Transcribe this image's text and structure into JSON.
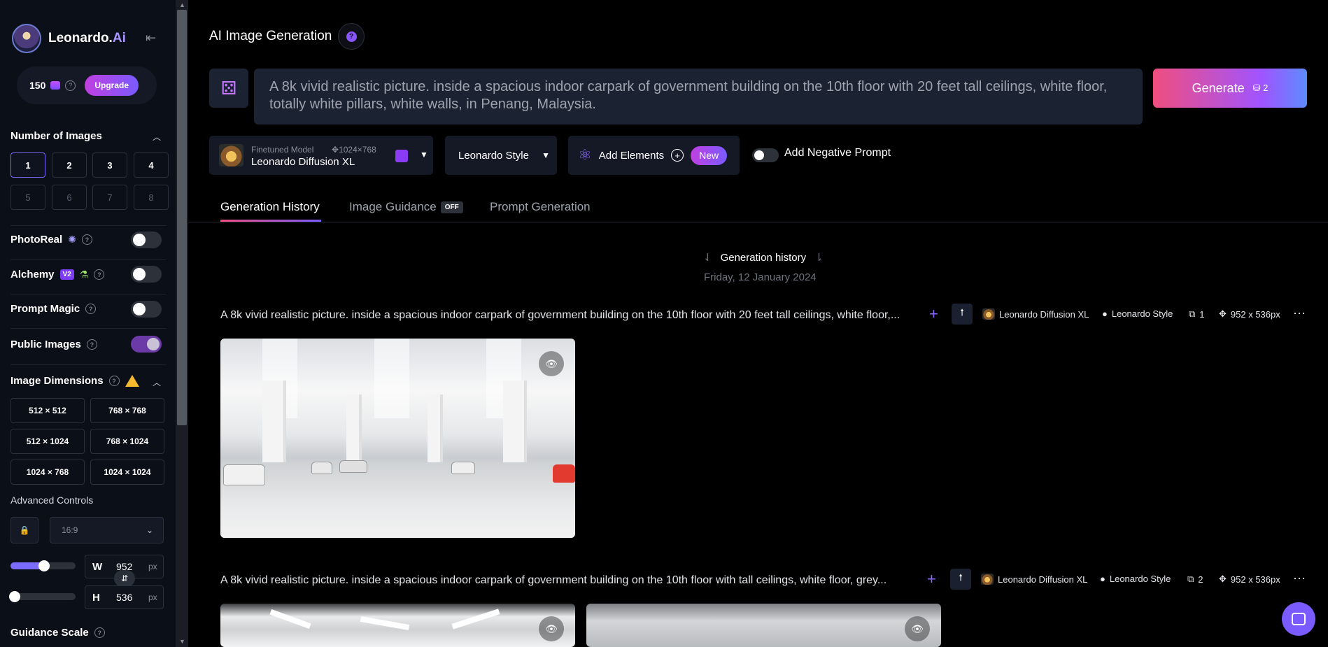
{
  "brand": {
    "name": "Leonardo.",
    "suffix": "Ai"
  },
  "tokens": {
    "count": "150",
    "upgrade_label": "Upgrade"
  },
  "sidebar": {
    "num_images_title": "Number of Images",
    "num_images": [
      "1",
      "2",
      "3",
      "4",
      "5",
      "6",
      "7",
      "8"
    ],
    "selected_num": "1",
    "photoreal_label": "PhotoReal",
    "alchemy_label": "Alchemy",
    "alchemy_badge": "V2",
    "prompt_magic_label": "Prompt Magic",
    "public_images_label": "Public Images",
    "image_dimensions_title": "Image Dimensions",
    "dimensions": [
      "512 × 512",
      "768 × 768",
      "512 × 1024",
      "768 × 1024",
      "1024 × 768",
      "1024 × 1024"
    ],
    "advanced_controls_label": "Advanced Controls",
    "aspect_ratio": "16:9",
    "width_label": "W",
    "width_value": "952",
    "height_label": "H",
    "height_value": "536",
    "unit": "px",
    "guidance_scale_label": "Guidance Scale",
    "toggles": {
      "photoreal": false,
      "alchemy": false,
      "prompt_magic": false,
      "public_images": true
    }
  },
  "header": {
    "title": "AI Image Generation"
  },
  "prompt": {
    "text": "A 8k vivid realistic picture. inside a spacious indoor carpark of government building on the 10th floor with 20 feet tall ceilings, white floor, totally white pillars, white walls, in Penang, Malaysia."
  },
  "generate": {
    "label": "Generate",
    "count": "2"
  },
  "model": {
    "sub_label": "Finetuned Model",
    "dimensions": "1024×768",
    "name": "Leonardo Diffusion XL"
  },
  "style": {
    "label": "Leonardo Style"
  },
  "elements": {
    "label": "Add Elements",
    "badge": "New"
  },
  "negative_prompt": {
    "label": "Add Negative Prompt"
  },
  "tabs": [
    {
      "label": "Generation History"
    },
    {
      "label": "Image Guidance",
      "badge": "OFF"
    },
    {
      "label": "Prompt Generation"
    }
  ],
  "history": {
    "heading": "Generation history",
    "date": "Friday, 12 January 2024",
    "generations": [
      {
        "prompt": "A 8k vivid realistic picture. inside a spacious indoor carpark of government building on the 10th floor with 20 feet tall ceilings, white floor,...",
        "model": "Leonardo Diffusion XL",
        "style": "Leonardo Style",
        "count": "1",
        "size": "952 x 536px"
      },
      {
        "prompt": "A 8k vivid realistic picture. inside a spacious indoor carpark of government building on the 10th floor with tall ceilings, white floor, grey...",
        "model": "Leonardo Diffusion XL",
        "style": "Leonardo Style",
        "count": "2",
        "size": "952 x 536px"
      }
    ]
  },
  "icons": {
    "collapse": "collapse-sidebar-icon",
    "help": "help-icon",
    "dice": "dice-icon",
    "eye": "eye-icon",
    "chat": "chat-icon"
  },
  "colors": {
    "accent": "#7b6bff",
    "generate_start": "#f04e7f",
    "generate_end": "#5d8bff",
    "bg": "#000000",
    "sidebar_bg": "#0b0f17"
  }
}
